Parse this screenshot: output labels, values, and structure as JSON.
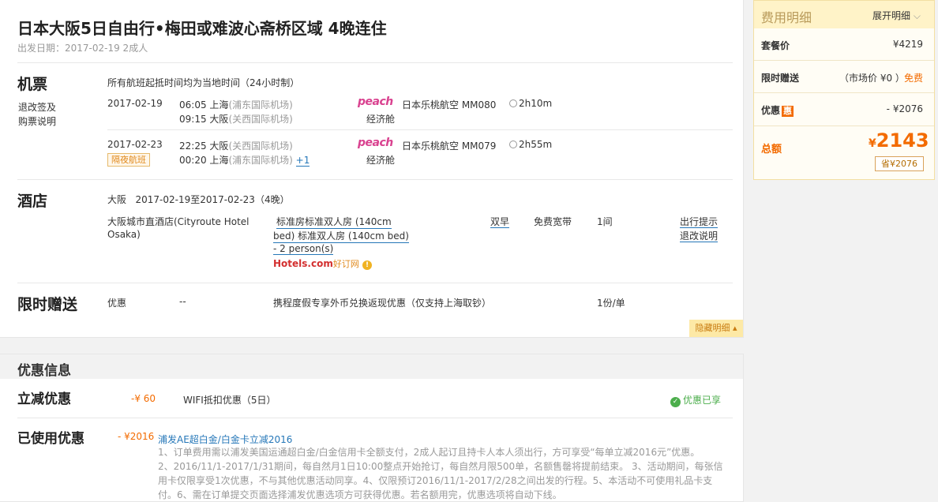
{
  "header": {
    "title": "日本大阪5日自由行•梅田或难波心斋桥区域 4晚连住",
    "subtitle": "出发日期：2017-02-19   2成人"
  },
  "flights": {
    "section_title": "机票",
    "links": [
      "退改签及",
      "购票说明"
    ],
    "note": "所有航班起抵时间均为当地时间（24小时制）",
    "legs": [
      {
        "date": "2017-02-19",
        "dep_time": "06:05",
        "dep_city": "上海",
        "dep_airport": "(浦东国际机场)",
        "arr_time": "09:15",
        "arr_city": "大阪",
        "arr_airport": "(关西国际机场)",
        "airline_logo": "peach",
        "flight": "日本乐桃航空 MM080",
        "cabin": "经济舱",
        "duration": "2h10m"
      },
      {
        "date": "2017-02-23",
        "dep_time": "22:25",
        "dep_city": "大阪",
        "dep_airport": "(关西国际机场)",
        "arr_time": "00:20",
        "arr_city": "上海",
        "arr_airport": "(浦东国际机场)",
        "next_day": "+1",
        "badge": "隔夜航班",
        "airline_logo": "peach",
        "flight": "日本乐桃航空 MM079",
        "cabin": "经济舱",
        "duration": "2h55m"
      }
    ]
  },
  "hotel": {
    "section_title": "酒店",
    "city": "大阪",
    "dates": "2017-02-19至2017-02-23（4晚）",
    "name_line1": "大阪城市直酒店(Cityroute Hotel",
    "name_line2": "Osaka)",
    "room_line1": "标准房标准双人房 (140cm",
    "room_line2": "bed) 标准双人房 (140cm bed)",
    "room_line3": "- 2 person(s)",
    "provider_brand": "Hotels.com",
    "provider_cn": "好订网",
    "breakfast": "双早",
    "wifi": "免费宽带",
    "rooms": "1间",
    "links": [
      "出行提示",
      "退改说明"
    ]
  },
  "gift": {
    "section_title": "限时赠送",
    "type": "优惠",
    "dash": "--",
    "desc": "携程度假专享外币兑换返现优惠（仅支持上海取钞）",
    "qty": "1份/单"
  },
  "hide_detail": "隐藏明细",
  "fee": {
    "title": "费用明细",
    "expand": "展开明细",
    "package_label": "套餐价",
    "package_value": "¥4219",
    "gift_label": "限时赠送",
    "gift_market": "（市场价 ¥0 ）",
    "gift_value": "免费",
    "discount_label": "优惠",
    "discount_badge": "惠",
    "discount_value": "- ¥2076",
    "total_label": "总额",
    "total_currency": "¥",
    "total_value": "2143",
    "save": "省¥2076"
  },
  "promo": {
    "header": "优惠信息",
    "instant_label": "立减优惠",
    "instant_amount": "-¥ 60",
    "instant_desc": "WIFI抵扣优惠（5日）",
    "instant_status": "优惠已享",
    "used_label": "已使用优惠",
    "used_amount": "- ¥2016",
    "used_title": "浦发AE超白金/白金卡立减2016",
    "used_desc_1": "1、订单费用需以浦发美国运通超白金/白金信用卡全额支付，2成人起订且持卡人本人须出行，方可享受“每单立减2016元”优惠。",
    "used_desc_2": "2、2016/11/1-2017/1/31期间，每自然月1日10:00整点开始抢订，每自然月限500单，名额售罄将提前结束。 3、活动期间，每张信",
    "used_desc_3": "用卡仅限享受1次优惠，不与其他优惠活动同享。4、仅限预订2016/11/1-2017/2/28之间出发的行程。5、本活动不可使用礼品卡支",
    "used_desc_4": "付。6、需在订单提交页面选择浦发优惠选项方可获得优惠。若名额用完，优惠选项将自动下线。"
  },
  "colors": {
    "link": "#2577b8",
    "accent": "#f36b00",
    "peach": "#d9418f",
    "success": "#4cae4c"
  }
}
